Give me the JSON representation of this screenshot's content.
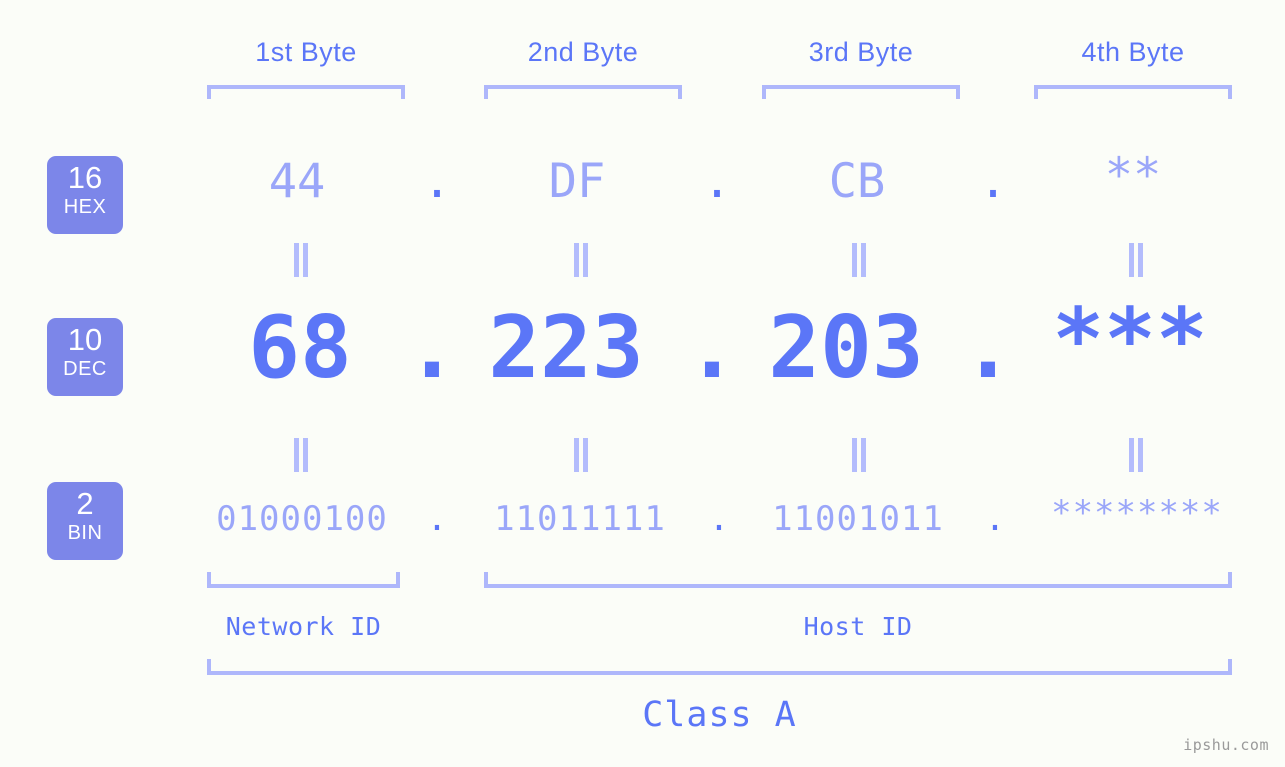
{
  "page": {
    "background_color": "#fbfdf8",
    "accent_primary": "#5b76f7",
    "accent_light": "#aab4fb",
    "badge_color": "#7c86e9",
    "watermark": "ipshu.com"
  },
  "byte_headers": [
    {
      "label": "1st Byte"
    },
    {
      "label": "2nd Byte"
    },
    {
      "label": "3rd Byte"
    },
    {
      "label": "4th Byte"
    }
  ],
  "rows": [
    {
      "key": "hex",
      "badge_number": "16",
      "badge_name": "HEX",
      "values": [
        "44",
        "DF",
        "CB",
        "**"
      ],
      "separator": "."
    },
    {
      "key": "dec",
      "badge_number": "10",
      "badge_name": "DEC",
      "values": [
        "68",
        "223",
        "203",
        "***"
      ],
      "separator": "."
    },
    {
      "key": "bin",
      "badge_number": "2",
      "badge_name": "BIN",
      "values": [
        "01000100",
        "11011111",
        "11001011",
        "********"
      ],
      "separator": "."
    }
  ],
  "sections": {
    "network_id": "Network ID",
    "host_id": "Host ID",
    "class": "Class A"
  }
}
